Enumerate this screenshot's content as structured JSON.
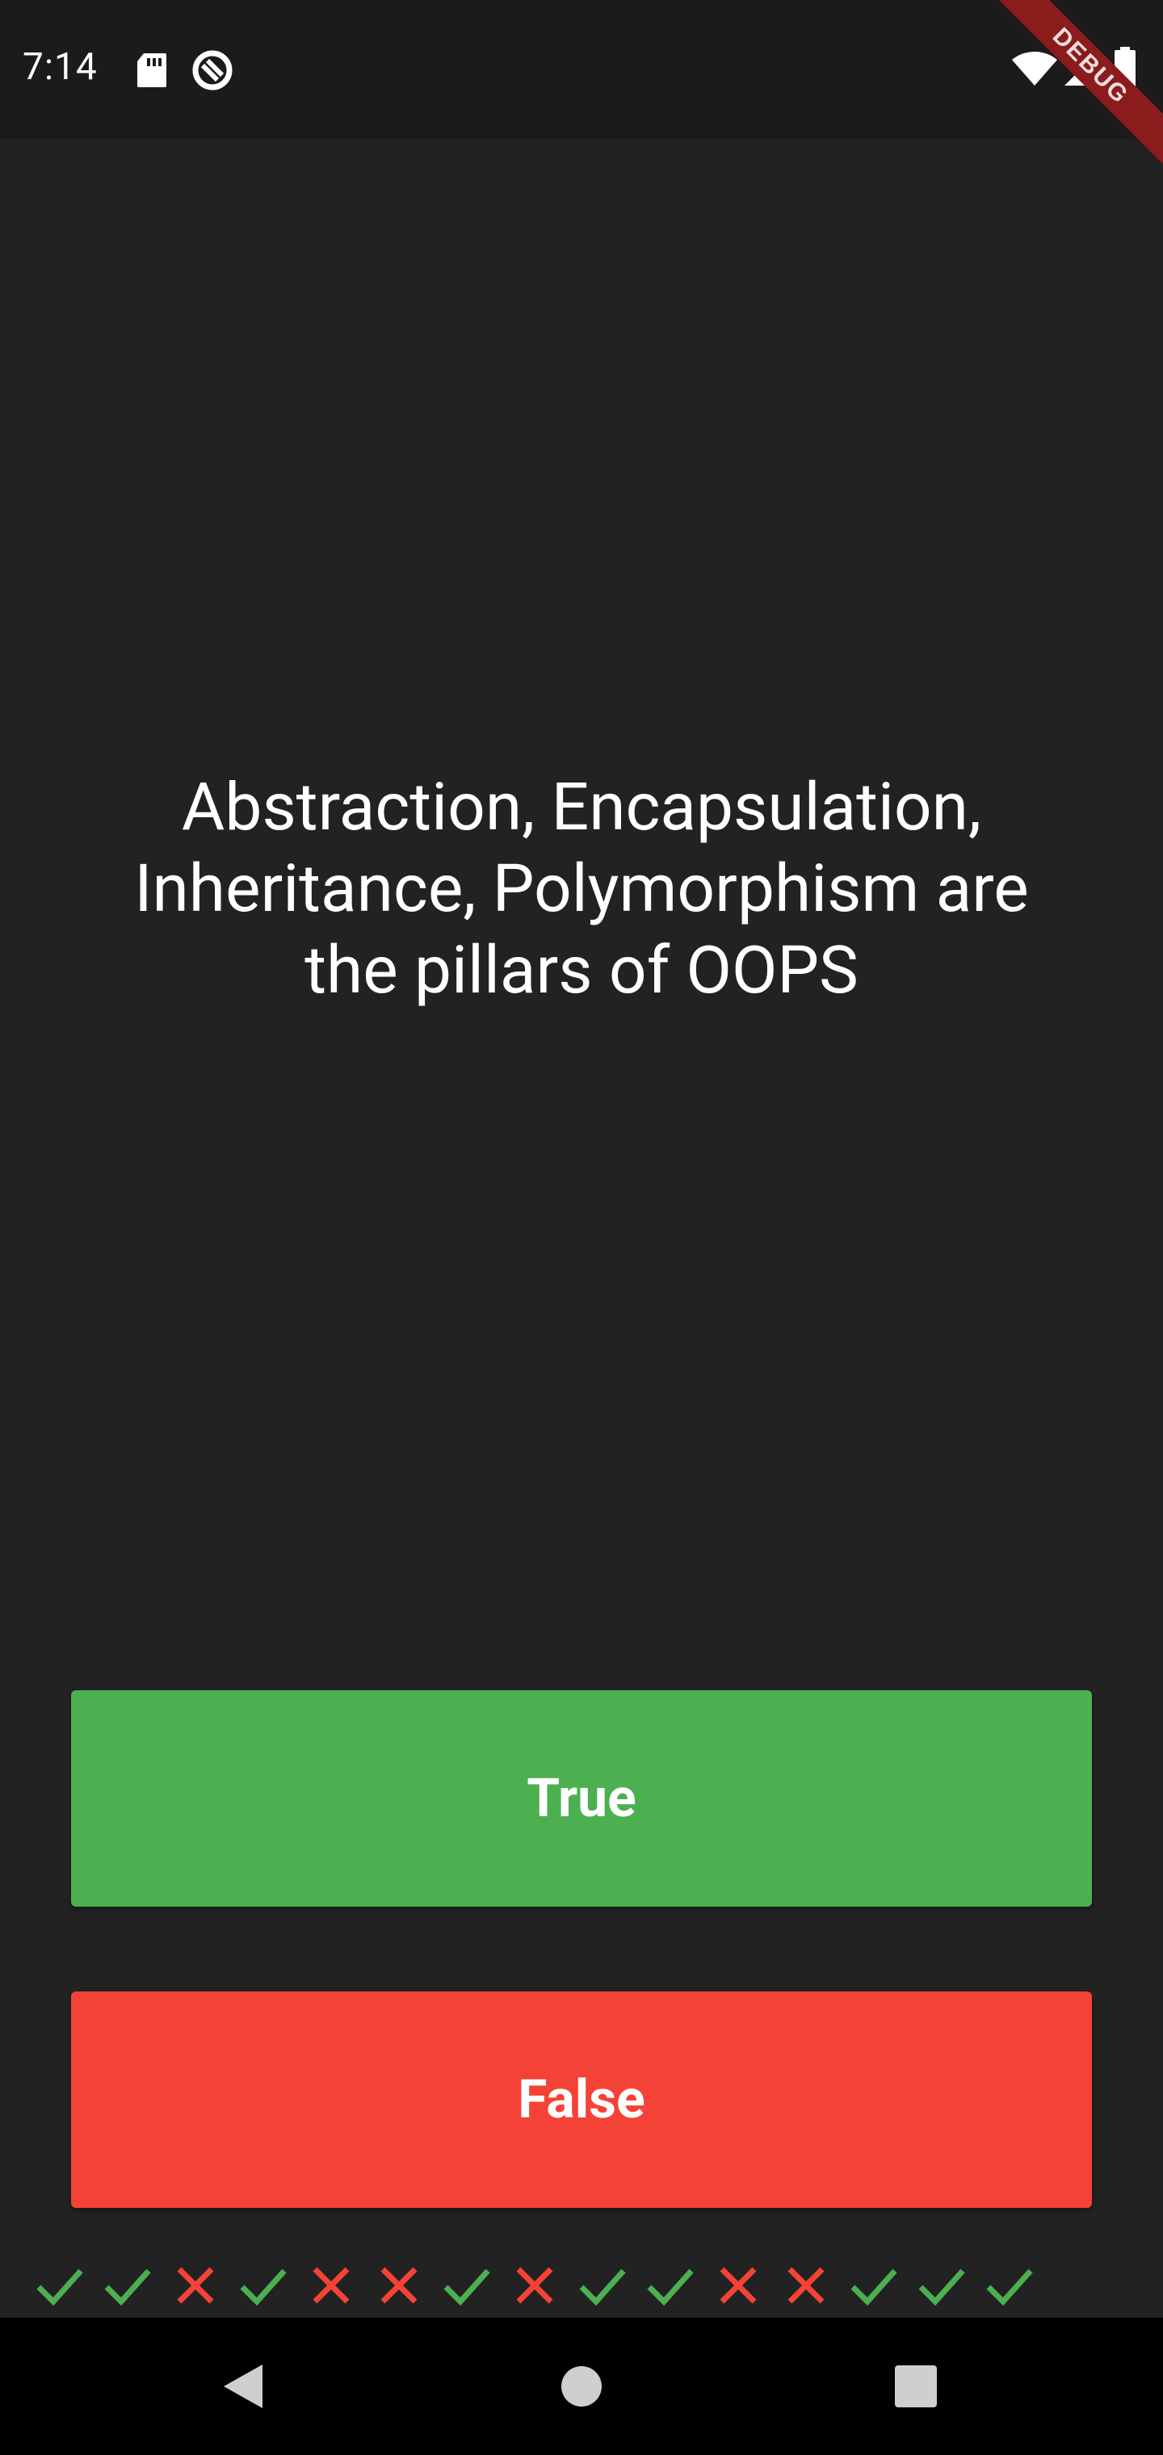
{
  "status_bar": {
    "time": "7:14",
    "icons": [
      "sd-card-icon",
      "sync-disabled-icon",
      "wifi-icon",
      "cell-signal-icon",
      "battery-icon"
    ],
    "debug_banner": "DEBUG"
  },
  "question": {
    "text": "Abstraction, Encapsulation, Inheritance, Polymorphism are the pillars of OOPS"
  },
  "buttons": {
    "true_label": "True",
    "false_label": "False"
  },
  "colors": {
    "background": "#222222",
    "true": "#4caf50",
    "false": "#f44336",
    "check": "#4caf50",
    "cross": "#f44336"
  },
  "score_keeper": [
    "check",
    "check",
    "close",
    "check",
    "close",
    "close",
    "check",
    "close",
    "check",
    "check",
    "close",
    "close",
    "check",
    "check",
    "check"
  ],
  "nav_bar": {
    "icons": [
      "back-icon",
      "home-icon",
      "recents-icon"
    ]
  }
}
